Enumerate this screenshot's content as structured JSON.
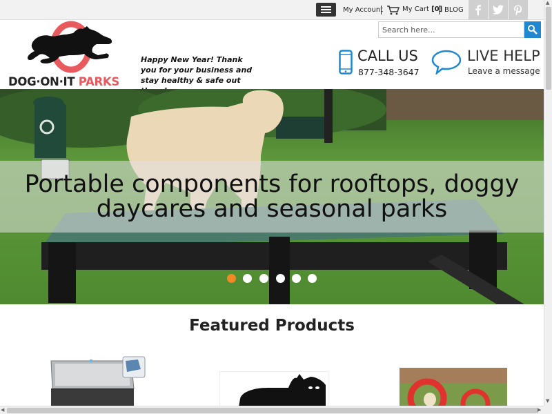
{
  "topbar": {
    "menu_icon": "hamburger-menu-icon",
    "my_account": "My Account",
    "my_cart_label": "My Cart",
    "my_cart_count": "[0]",
    "blog": "BLOG",
    "social": [
      "facebook-icon",
      "twitter-icon",
      "pinterest-icon"
    ]
  },
  "header": {
    "logo_text_part1": "DOG·ON·IT ",
    "logo_text_part2": "PARKS",
    "greeting": "Happy New Year! Thank you for your business and stay healthy & safe out there!",
    "search_placeholder": "Search here...",
    "call_us": "CALL US",
    "phone": "877-348-3647",
    "live_help": "LIVE HELP",
    "leave_message": "Leave a message"
  },
  "hero": {
    "caption_line1": "Portable components for rooftops, doggy",
    "caption_line2": "daycares and seasonal parks",
    "slide_count": 6,
    "active_slide": 1
  },
  "featured": {
    "title": "Featured Products"
  },
  "colors": {
    "brand_red": "#e85a5e",
    "accent_blue": "#1f88cf",
    "active_dot": "#f08a24",
    "topbar_bg": "#f2f2f2"
  }
}
